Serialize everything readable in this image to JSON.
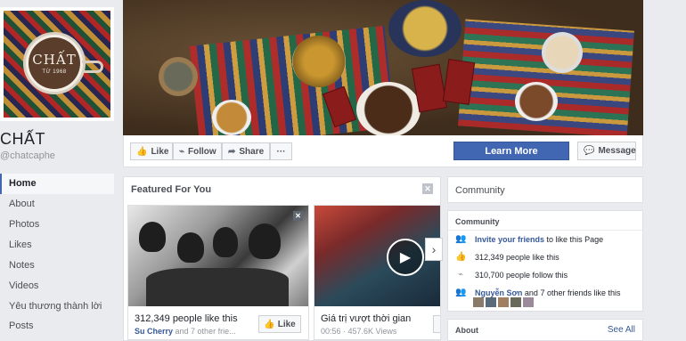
{
  "profile": {
    "logo_brand": "CHẤT",
    "logo_since": "TỪ 1968",
    "name": "CHẤT",
    "handle": "@chatcaphe"
  },
  "left_nav": [
    {
      "label": "Home",
      "active": true
    },
    {
      "label": "About"
    },
    {
      "label": "Photos"
    },
    {
      "label": "Likes"
    },
    {
      "label": "Notes"
    },
    {
      "label": "Videos"
    },
    {
      "label": "Yêu thương thành lời"
    },
    {
      "label": "Posts"
    }
  ],
  "action_bar": {
    "like_label": "Like",
    "follow_label": "Follow",
    "share_label": "Share",
    "more_label": "···",
    "learn_more_label": "Learn More",
    "message_label": "Message"
  },
  "featured": {
    "title": "Featured For You",
    "cards": [
      {
        "line1": "312,349 people like this",
        "friend": "Su Cherry",
        "line2": "and 7 other frie...",
        "like_label": "Like"
      },
      {
        "line1": "Giá trị vượt thời gian",
        "line2": "00:56 · 457.6K Views"
      }
    ]
  },
  "community": {
    "header": "Community",
    "box_title": "Community",
    "invite_link": "Invite your friends",
    "invite_rest": "to like this Page",
    "likes_text": "312,349 people like this",
    "follows_text": "310,700 people follow this",
    "friend_name": "Nguyễn Sơn",
    "friend_rest": "and 7 other friends like this"
  },
  "about": {
    "title": "About",
    "see_all": "See All"
  },
  "colors": {
    "brand_blue": "#4267b2",
    "link_blue": "#365899",
    "background": "#e9ebee"
  }
}
